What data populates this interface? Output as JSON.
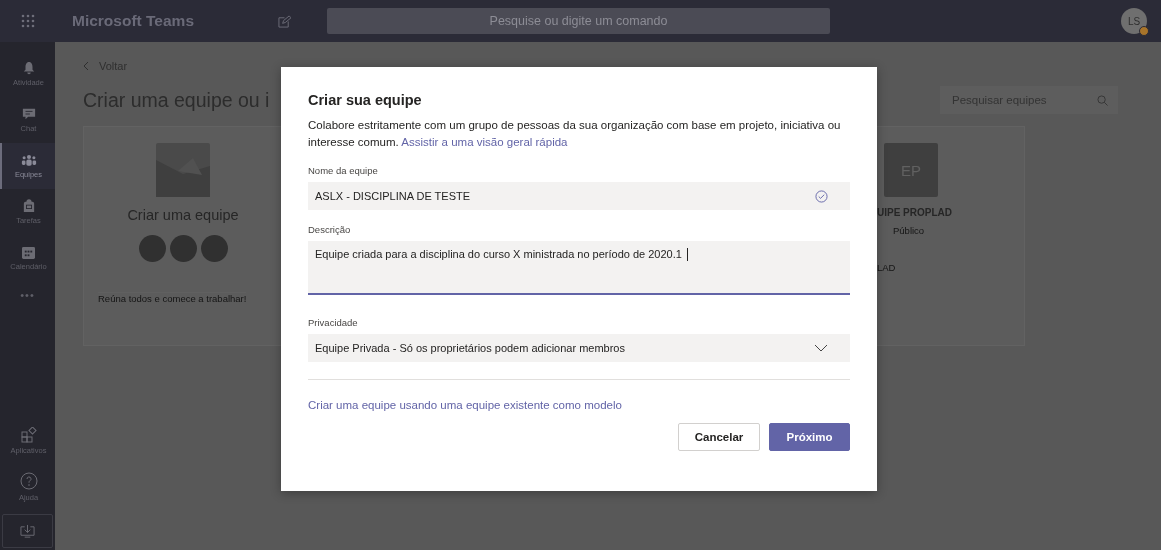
{
  "top_bar": {
    "app_name": "Microsoft Teams",
    "search": {
      "placeholder": "Pesquise ou digite um comando"
    },
    "avatar": {
      "initials": "LS"
    }
  },
  "sidebar": {
    "items": [
      {
        "label": "Atividade",
        "selected": false
      },
      {
        "label": "Chat",
        "selected": false
      },
      {
        "label": "Equipes",
        "selected": true
      },
      {
        "label": "Tarefas",
        "selected": false
      },
      {
        "label": "Calendário",
        "selected": false
      }
    ],
    "more": "•••",
    "bottom_items": [
      {
        "label": "Aplicativos"
      },
      {
        "label": "Ajuda"
      }
    ]
  },
  "page": {
    "back": "Voltar",
    "title": "Criar uma equipe ou i",
    "search": {
      "placeholder": "Pesquisar equipes"
    },
    "cards": [
      {
        "kind": "create",
        "title": "Criar uma equipe",
        "footer": "Reúna todos e comece a trabalhar!"
      },
      {
        "kind": "team",
        "initials": "EP",
        "title": "UIPE PROPLAD",
        "subtitle": "Público",
        "footer": "LAD"
      }
    ]
  },
  "dialog": {
    "title": "Criar sua equipe",
    "description": "Colabore estritamente com um grupo de pessoas da sua organização com base em projeto, iniciativa ou interesse comum.",
    "description_link": "Assistir a uma visão geral rápida",
    "name_label": "Nome da equipe",
    "name_value": "ASLX - DISCIPLINA DE TESTE",
    "name_valid": true,
    "description_label": "Descrição",
    "description_value": "Equipe criada para a disciplina do curso X ministrada no período de 2020.1",
    "privacy_label": "Privacidade",
    "privacy_value": "Equipe Privada - Só os proprietários podem adicionar membros",
    "template_link": "Criar uma equipe usando uma equipe existente como modelo",
    "buttons": [
      {
        "label": "Cancelar",
        "kind": "secondary"
      },
      {
        "label": "Próximo",
        "kind": "primary"
      }
    ]
  }
}
